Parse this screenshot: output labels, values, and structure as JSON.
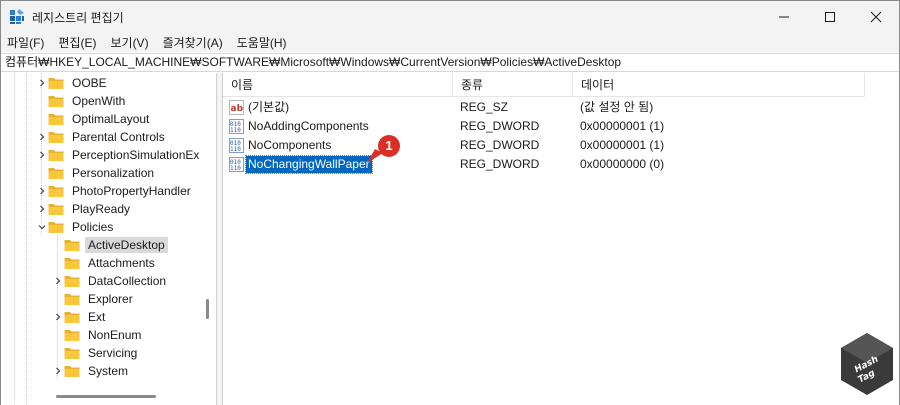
{
  "window": {
    "title": "레지스트리 편집기"
  },
  "menu": [
    "파일(F)",
    "편집(E)",
    "보기(V)",
    "즐겨찾기(A)",
    "도움말(H)"
  ],
  "address": "컴퓨터₩HKEY_LOCAL_MACHINE₩SOFTWARE₩Microsoft₩Windows₩CurrentVersion₩Policies₩ActiveDesktop",
  "tree": [
    {
      "label": "OOBE",
      "expander": "collapsed"
    },
    {
      "label": "OpenWith",
      "expander": "none"
    },
    {
      "label": "OptimalLayout",
      "expander": "none"
    },
    {
      "label": "Parental Controls",
      "expander": "collapsed"
    },
    {
      "label": "PerceptionSimulationEx",
      "expander": "collapsed"
    },
    {
      "label": "Personalization",
      "expander": "none"
    },
    {
      "label": "PhotoPropertyHandler",
      "expander": "collapsed"
    },
    {
      "label": "PlayReady",
      "expander": "collapsed"
    },
    {
      "label": "Policies",
      "expander": "expanded"
    },
    {
      "label": "ActiveDesktop",
      "expander": "none",
      "selected": true
    },
    {
      "label": "Attachments",
      "expander": "none"
    },
    {
      "label": "DataCollection",
      "expander": "collapsed"
    },
    {
      "label": "Explorer",
      "expander": "none"
    },
    {
      "label": "Ext",
      "expander": "collapsed"
    },
    {
      "label": "NonEnum",
      "expander": "none"
    },
    {
      "label": "Servicing",
      "expander": "none"
    },
    {
      "label": "System",
      "expander": "collapsed"
    }
  ],
  "list": {
    "columns": {
      "name": "이름",
      "type": "종류",
      "data": "데이터"
    },
    "rows": [
      {
        "name": "(기본값)",
        "type": "REG_SZ",
        "data": "(값 설정 안 됨)",
        "icon": "string-value-icon"
      },
      {
        "name": "NoAddingComponents",
        "type": "REG_DWORD",
        "data": "0x00000001 (1)",
        "icon": "dword-value-icon"
      },
      {
        "name": "NoComponents",
        "type": "REG_DWORD",
        "data": "0x00000001 (1)",
        "icon": "dword-value-icon"
      },
      {
        "name": "NoChangingWallPaper",
        "type": "REG_DWORD",
        "data": "0x00000000 (0)",
        "icon": "dword-value-icon",
        "selected": true
      }
    ]
  },
  "annotation": {
    "badge": "1",
    "color": "#d93025"
  },
  "colors": {
    "selection": "#0067c0",
    "folder": "#f8c83c",
    "titlebar": "#f3f3f3"
  }
}
